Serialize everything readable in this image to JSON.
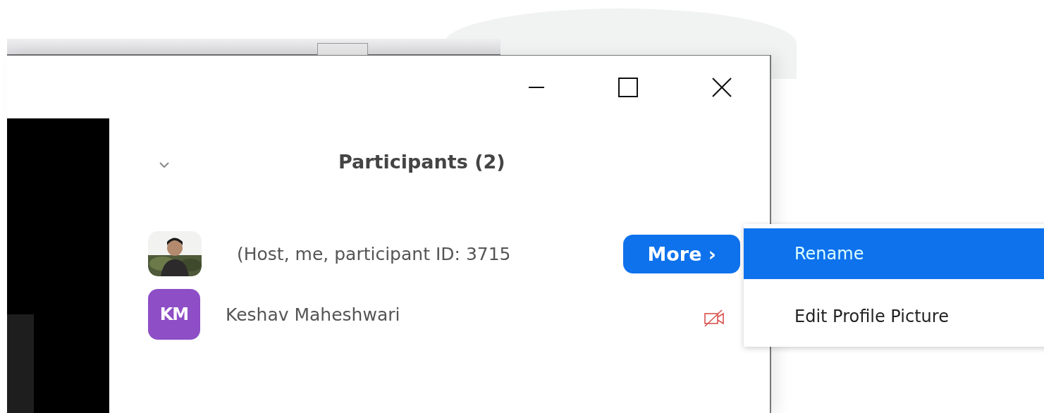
{
  "panel": {
    "title": "Participants (2)"
  },
  "participants": [
    {
      "name": "(Host, me, participant ID: 3715",
      "video_off": false,
      "button": "More ›"
    },
    {
      "kind": "initials",
      "initials": "KM",
      "color": "#8e4ec6",
      "name": "Keshav Maheshwari",
      "video_off": true
    }
  ],
  "menu": [
    {
      "label": "Rename",
      "selected": true
    },
    {
      "label": "Edit Profile Picture",
      "selected": false
    }
  ]
}
